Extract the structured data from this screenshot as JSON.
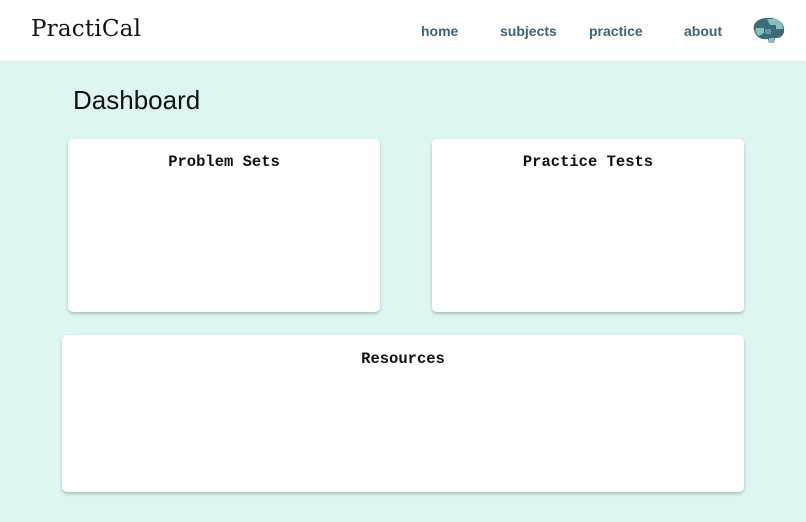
{
  "header": {
    "brand": "PractiCal",
    "nav": [
      {
        "label": "home"
      },
      {
        "label": "subjects"
      },
      {
        "label": "practice"
      },
      {
        "label": "about"
      }
    ],
    "logo_icon": "brain-icon"
  },
  "main": {
    "title": "Dashboard",
    "cards": [
      {
        "title": "Problem Sets"
      },
      {
        "title": "Practice Tests"
      },
      {
        "title": "Resources"
      }
    ]
  },
  "colors": {
    "background": "#ddf6f2",
    "nav_link": "#3d6378",
    "card": "#ffffff",
    "brain_dark": "#3e6b77",
    "brain_light": "#86c1bf"
  }
}
